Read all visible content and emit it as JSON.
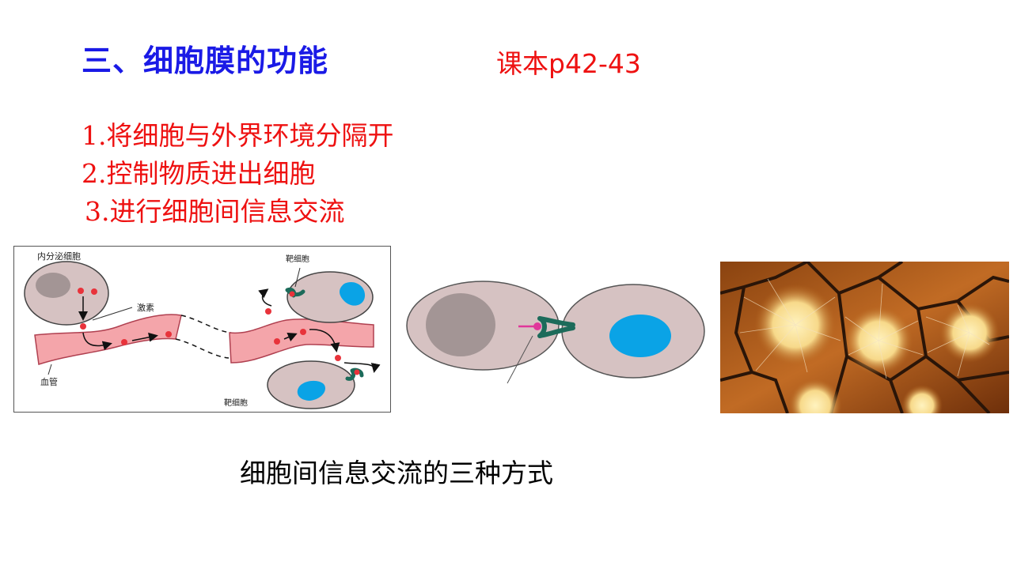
{
  "slide": {
    "title": "三、细胞膜的功能",
    "reference": "课本p42-43",
    "points": [
      "1.将细胞与外界环境分隔开",
      "2.控制物质进出细胞",
      "3.进行细胞间信息交流"
    ],
    "caption": "细胞间信息交流的三种方式"
  },
  "figure1": {
    "endocrine_cell": "内分泌细胞",
    "hormone": "激素",
    "blood_vessel": "血管",
    "target_cell_top": "靶细胞",
    "target_cell_bottom": "靶细胞"
  },
  "colors": {
    "title": "#1a1ae6",
    "text_red": "#ee1111",
    "cell_fill": "#d6c2c2",
    "nucleus_blue": "#0aa3e6",
    "vessel": "#f4a5aa",
    "receptor": "#1c6b5a",
    "signal_dot": "#e8333b"
  }
}
